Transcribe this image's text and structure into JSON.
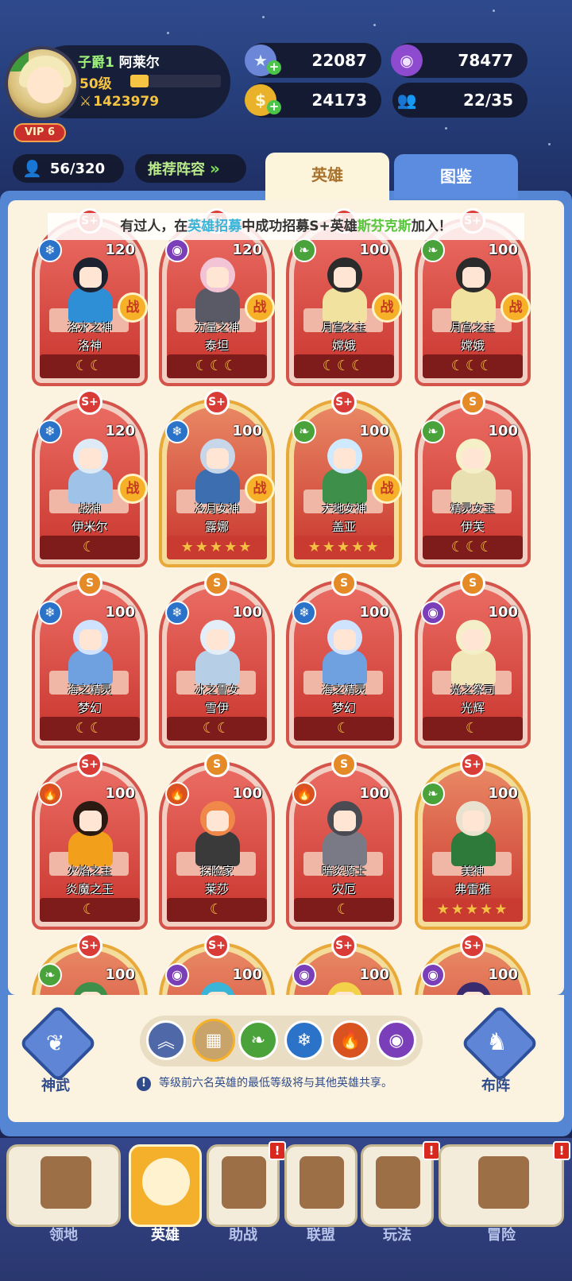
{
  "player": {
    "rank": "子爵1",
    "name": "阿莱尔",
    "level": "50级",
    "xp_fraction": 0.2,
    "power": "1423979",
    "vip": "VIP 6"
  },
  "resources": {
    "crystal": "22087",
    "purple_coin": "78477",
    "gold": "24173",
    "members": "22/35"
  },
  "hero_count": "56/320",
  "recommend_label": "推荐阵容",
  "tabs": {
    "heroes": "英雄",
    "codex": "图鉴"
  },
  "ticker": {
    "prefix": "有过人，在",
    "event": "英雄招募",
    "mid": "中成功招募S+英雄",
    "hero": "斯芬克斯",
    "suffix": "加入！"
  },
  "fight_label": "战",
  "cards": [
    {
      "grade": "S+",
      "element": "ice",
      "level": "120",
      "title": "洛水之神",
      "name": "洛神",
      "moons": "☾☾",
      "frame": "red",
      "fight": true
    },
    {
      "grade": "S+",
      "element": "dark",
      "level": "120",
      "title": "力量之神",
      "name": "泰坦",
      "moons": "☾☾☾",
      "frame": "red",
      "fight": true
    },
    {
      "grade": "S+",
      "element": "nature",
      "level": "100",
      "title": "月宫之主",
      "name": "嫦娥",
      "moons": "☾☾☾",
      "frame": "red",
      "fight": true
    },
    {
      "grade": "S+",
      "element": "nature",
      "level": "100",
      "title": "月宫之主",
      "name": "嫦娥",
      "moons": "☾☾☾",
      "frame": "red",
      "fight": true
    },
    {
      "grade": "S+",
      "element": "ice",
      "level": "120",
      "title": "战神",
      "name": "伊米尔",
      "moons": "☾",
      "frame": "red",
      "fight": true
    },
    {
      "grade": "S+",
      "element": "ice",
      "level": "100",
      "title": "冷月女神",
      "name": "露娜",
      "moons": "★★★★★",
      "frame": "gold",
      "fight": true
    },
    {
      "grade": "S+",
      "element": "nature",
      "level": "100",
      "title": "大地女神",
      "name": "盖亚",
      "moons": "★★★★★",
      "frame": "gold",
      "fight": true
    },
    {
      "grade": "S",
      "element": "nature",
      "level": "100",
      "title": "精灵女王",
      "name": "伊芙",
      "moons": "☾☾☾",
      "frame": "red",
      "fight": false
    },
    {
      "grade": "S",
      "element": "ice",
      "level": "100",
      "title": "海之精灵",
      "name": "梦幻",
      "moons": "☾☾",
      "frame": "red",
      "fight": false
    },
    {
      "grade": "S",
      "element": "ice",
      "level": "100",
      "title": "冰之雪女",
      "name": "雪伊",
      "moons": "☾☾",
      "frame": "red",
      "fight": false
    },
    {
      "grade": "S",
      "element": "ice",
      "level": "100",
      "title": "海之精灵",
      "name": "梦幻",
      "moons": "☾",
      "frame": "red",
      "fight": false
    },
    {
      "grade": "S",
      "element": "dark",
      "level": "100",
      "title": "光之祭司",
      "name": "光辉",
      "moons": "☾",
      "frame": "red",
      "fight": false
    },
    {
      "grade": "S+",
      "element": "fire",
      "level": "100",
      "title": "火焰之主",
      "name": "炎魔之王",
      "moons": "☾",
      "frame": "red",
      "fight": false
    },
    {
      "grade": "S",
      "element": "fire",
      "level": "100",
      "title": "探险家",
      "name": "莱莎",
      "moons": "☾",
      "frame": "red",
      "fight": false
    },
    {
      "grade": "S",
      "element": "fire",
      "level": "100",
      "title": "暗炎骑士",
      "name": "灾厄",
      "moons": "☾",
      "frame": "red",
      "fight": false
    },
    {
      "grade": "S+",
      "element": "nature",
      "level": "100",
      "title": "美神",
      "name": "弗雷雅",
      "moons": "★★★★★",
      "frame": "gold",
      "fight": false
    },
    {
      "grade": "S+",
      "element": "nature",
      "level": "100",
      "title": "",
      "name": "",
      "moons": "",
      "frame": "gold",
      "fight": false
    },
    {
      "grade": "S+",
      "element": "dark",
      "level": "100",
      "title": "",
      "name": "",
      "moons": "",
      "frame": "gold",
      "fight": false
    },
    {
      "grade": "S+",
      "element": "dark",
      "level": "100",
      "title": "",
      "name": "",
      "moons": "",
      "frame": "gold",
      "fight": false
    },
    {
      "grade": "S+",
      "element": "dark",
      "level": "100",
      "title": "",
      "name": "",
      "moons": "",
      "frame": "gold",
      "fight": false
    }
  ],
  "element_colors": {
    "ice": "#2b72c9",
    "dark": "#7a3fb8",
    "nature": "#4aa33a",
    "fire": "#d8531f"
  },
  "controls": {
    "shenwu": "神武",
    "buzhen": "布阵",
    "note": "等级前六名英雄的最低等级将与其他英雄共享。"
  },
  "filters": [
    "rank-icon",
    "all-icon",
    "nature-icon",
    "ice-icon",
    "fire-icon",
    "dark-icon"
  ],
  "nav": [
    {
      "label": "领地",
      "alert": false
    },
    {
      "label": "英雄",
      "alert": false
    },
    {
      "label": "助战",
      "alert": true
    },
    {
      "label": "联盟",
      "alert": false
    },
    {
      "label": "玩法",
      "alert": true
    },
    {
      "label": "冒险",
      "alert": true
    }
  ]
}
